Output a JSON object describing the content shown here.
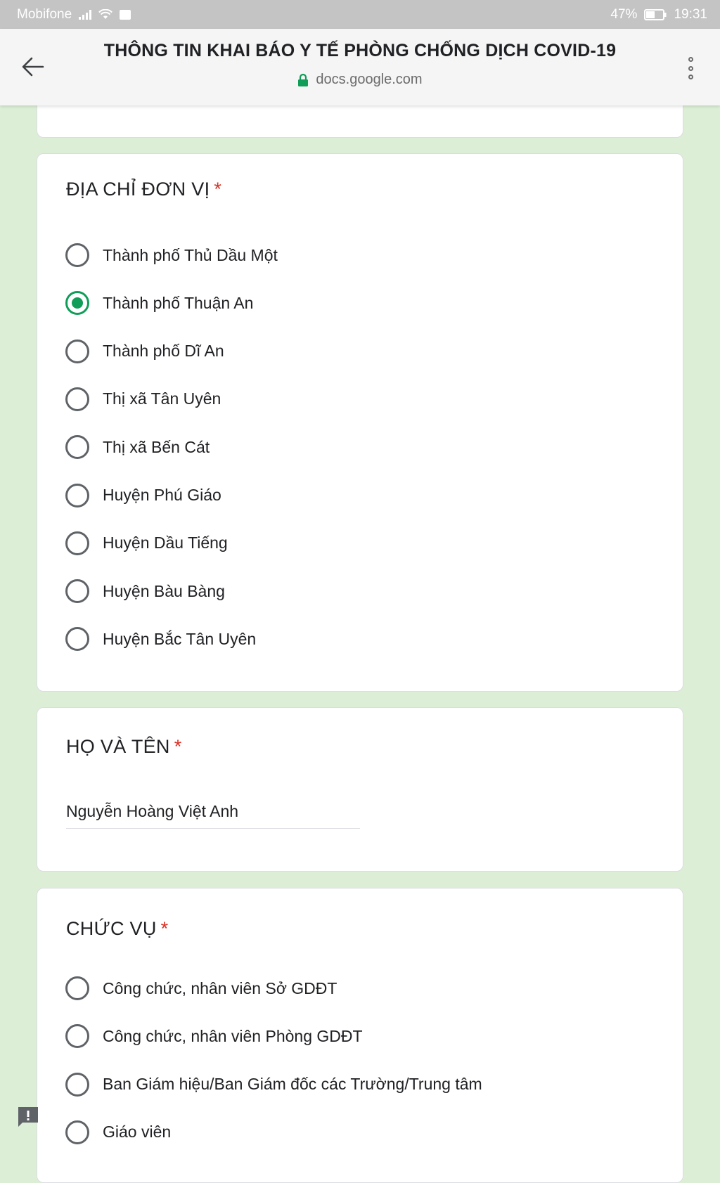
{
  "status_bar": {
    "carrier": "Mobifone",
    "battery": "47%",
    "time": "19:31"
  },
  "header": {
    "title": "THÔNG TIN KHAI BÁO Y TẾ PHÒNG CHỐNG DỊCH COVID-19",
    "url": "docs.google.com"
  },
  "questions": {
    "address": {
      "title": "ĐỊA CHỈ ĐƠN VỊ",
      "required": "*",
      "selected": "Thành phố Thuận An",
      "options": [
        "Thành phố Thủ Dầu Một",
        "Thành phố Thuận An",
        "Thành phố Dĩ An",
        "Thị xã Tân Uyên",
        "Thị xã Bến Cát",
        "Huyện Phú Giáo",
        "Huyện Dầu Tiếng",
        "Huyện Bàu Bàng",
        "Huyện Bắc Tân Uyên"
      ]
    },
    "full_name": {
      "title": "HỌ VÀ TÊN",
      "required": "*",
      "value": "Nguyễn Hoàng Việt Anh"
    },
    "position": {
      "title": "CHỨC VỤ",
      "required": "*",
      "options": [
        "Công chức, nhân viên Sở GDĐT",
        "Công chức, nhân viên Phòng GDĐT",
        "Ban Giám hiệu/Ban Giám đốc các Trường/Trung tâm",
        "Giáo viên"
      ]
    }
  },
  "colors": {
    "page_background": "#dcefd6",
    "accent_green": "#0f9d58",
    "required_red": "#d93025"
  },
  "icons": {
    "back": "arrow-left-icon",
    "lock": "lock-icon",
    "more": "more-vertical-icon",
    "feedback": "feedback-icon"
  }
}
